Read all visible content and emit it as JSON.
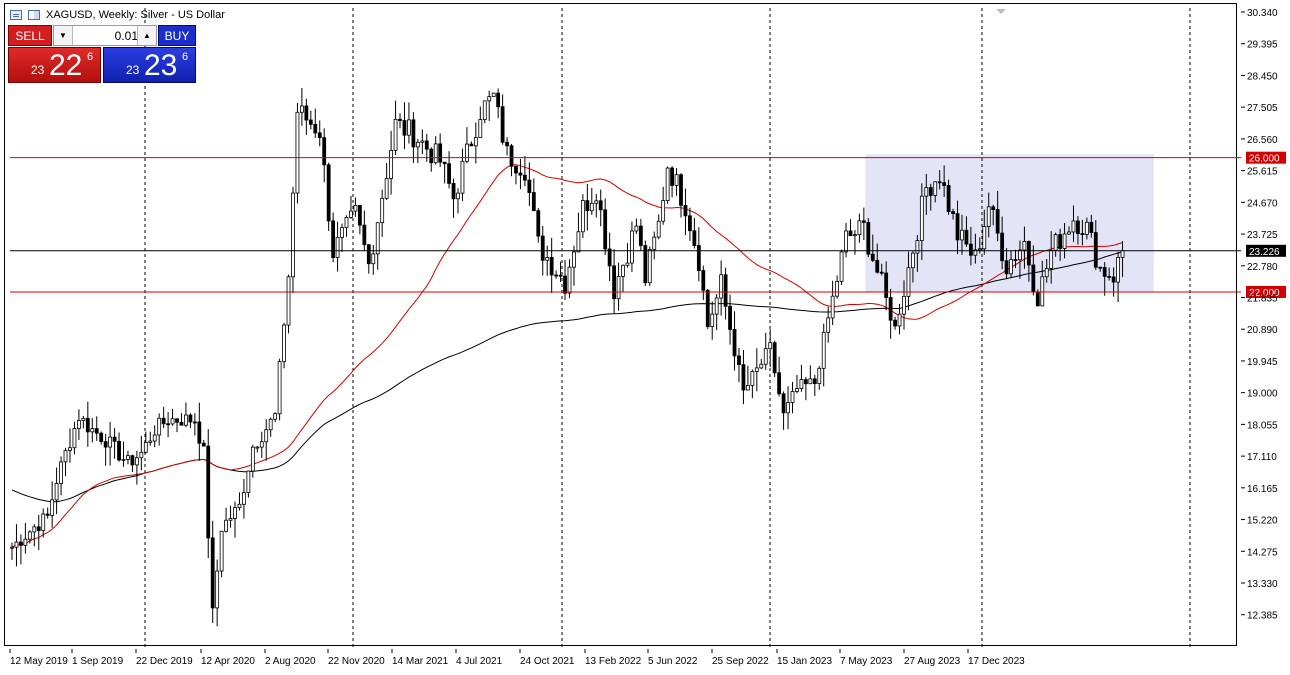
{
  "toolbar": {
    "title": "XAGUSD, Weekly:  Silver - US Dollar",
    "menu_icon": "chart-list-icon",
    "window_icon": "window-tile-icon"
  },
  "trade_panel": {
    "sell_label": "SELL",
    "buy_label": "BUY",
    "lot_value": "0.01",
    "sell_price": {
      "small": "23",
      "big": "22",
      "sup": "6"
    },
    "buy_price": {
      "small": "23",
      "big": "23",
      "sup": "6"
    },
    "colors": {
      "sell": "#d11f1f",
      "buy": "#1c2fc8"
    }
  },
  "chart_data": {
    "type": "candlestick",
    "symbol": "XAGUSD",
    "timeframe": "Weekly",
    "ylim": [
      11.9,
      30.34
    ],
    "y_ticks": [
      "30.340",
      "29.395",
      "28.450",
      "27.505",
      "26.560",
      "25.615",
      "24.670",
      "23.725",
      "22.780",
      "21.835",
      "20.890",
      "19.945",
      "19.000",
      "18.055",
      "17.110",
      "16.165",
      "15.220",
      "14.275",
      "13.330",
      "12.385"
    ],
    "x_ticks": [
      "12 May 2019",
      "1 Sep 2019",
      "22 Dec 2019",
      "12 Apr 2020",
      "2 Aug 2020",
      "22 Nov 2020",
      "14 Mar 2021",
      "4 Jul 2021",
      "24 Oct 2021",
      "13 Feb 2022",
      "5 Jun 2022",
      "25 Sep 2022",
      "15 Jan 2023",
      "7 May 2023",
      "27 Aug 2023",
      "17 Dec 2023"
    ],
    "grid": "vertical dashed separators",
    "horizontal_levels": [
      {
        "value": 26.0,
        "label": "26.000",
        "color": "#d40000"
      },
      {
        "value": 22.0,
        "label": "22.000",
        "color": "#d40000"
      },
      {
        "value": 23.226,
        "label": "23.226",
        "color": "#000000"
      }
    ],
    "range_box": {
      "from": "15 Jan 2023",
      "to_week_after_last": 7,
      "low": 22.0,
      "high": 26.1,
      "color": "#e3e5f7"
    },
    "moving_averages": [
      {
        "name": "MA50",
        "color": "#d40000"
      },
      {
        "name": "MA200",
        "color": "#000000"
      }
    ],
    "anchors": [
      [
        "2019-05-12",
        14.4
      ],
      [
        "2019-06-16",
        15.0
      ],
      [
        "2019-07-07",
        15.3
      ],
      [
        "2019-07-21",
        16.4
      ],
      [
        "2019-08-04",
        17.2
      ],
      [
        "2019-08-25",
        18.3
      ],
      [
        "2019-09-08",
        18.0
      ],
      [
        "2019-10-06",
        17.6
      ],
      [
        "2019-11-10",
        16.9
      ],
      [
        "2019-12-01",
        17.2
      ],
      [
        "2019-12-22",
        17.9
      ],
      [
        "2020-01-12",
        18.2
      ],
      [
        "2020-02-23",
        18.2
      ],
      [
        "2020-03-08",
        17.2
      ],
      [
        "2020-03-22",
        12.4
      ],
      [
        "2020-04-05",
        15.0
      ],
      [
        "2020-05-03",
        15.6
      ],
      [
        "2020-05-24",
        17.4
      ],
      [
        "2020-06-28",
        18.3
      ],
      [
        "2020-07-19",
        22.5
      ],
      [
        "2020-08-02",
        27.4
      ],
      [
        "2020-09-06",
        26.8
      ],
      [
        "2020-09-27",
        23.2
      ],
      [
        "2020-11-01",
        24.3
      ],
      [
        "2020-11-22",
        22.8
      ],
      [
        "2021-01-03",
        27.0
      ],
      [
        "2021-01-31",
        26.7
      ],
      [
        "2021-03-14",
        25.9
      ],
      [
        "2021-04-04",
        24.8
      ],
      [
        "2021-05-16",
        27.4
      ],
      [
        "2021-06-06",
        27.8
      ],
      [
        "2021-06-27",
        26.1
      ],
      [
        "2021-07-25",
        25.7
      ],
      [
        "2021-08-15",
        23.4
      ],
      [
        "2021-09-26",
        22.3
      ],
      [
        "2021-10-24",
        24.5
      ],
      [
        "2021-11-14",
        25.1
      ],
      [
        "2021-12-12",
        22.1
      ],
      [
        "2022-01-16",
        24.0
      ],
      [
        "2022-01-30",
        22.4
      ],
      [
        "2022-02-20",
        24.0
      ],
      [
        "2022-03-06",
        25.8
      ],
      [
        "2022-04-03",
        24.6
      ],
      [
        "2022-04-24",
        23.0
      ],
      [
        "2022-05-08",
        21.0
      ],
      [
        "2022-05-29",
        22.2
      ],
      [
        "2022-07-03",
        19.0
      ],
      [
        "2022-08-14",
        20.3
      ],
      [
        "2022-09-04",
        18.3
      ],
      [
        "2022-09-25",
        19.1
      ],
      [
        "2022-10-23",
        19.3
      ],
      [
        "2022-11-13",
        21.2
      ],
      [
        "2022-12-11",
        23.6
      ],
      [
        "2023-01-08",
        23.9
      ],
      [
        "2023-02-26",
        20.9
      ],
      [
        "2023-03-19",
        22.7
      ],
      [
        "2023-04-16",
        25.1
      ],
      [
        "2023-05-07",
        25.5
      ],
      [
        "2023-06-04",
        23.7
      ],
      [
        "2023-07-02",
        23.0
      ],
      [
        "2023-07-23",
        24.6
      ],
      [
        "2023-08-20",
        22.8
      ],
      [
        "2023-09-17",
        23.5
      ],
      [
        "2023-10-08",
        21.8
      ],
      [
        "2023-10-29",
        23.2
      ],
      [
        "2023-12-03",
        24.2
      ],
      [
        "2023-12-24",
        23.9
      ],
      [
        "2024-01-14",
        22.7
      ],
      [
        "2024-02-04",
        22.5
      ],
      [
        "2024-02-18",
        23.2
      ]
    ]
  }
}
